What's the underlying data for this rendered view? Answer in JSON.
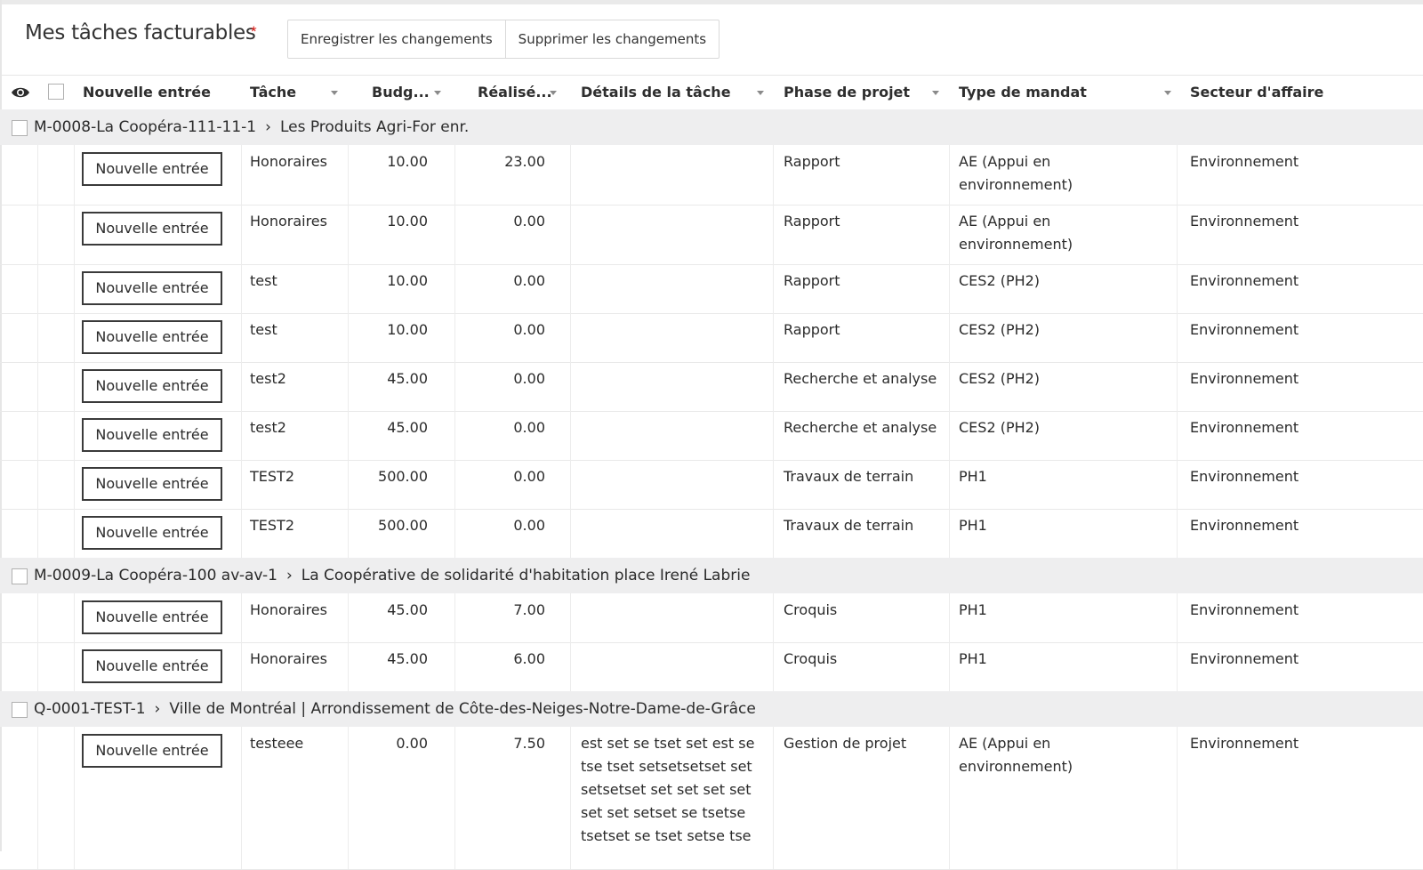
{
  "page": {
    "title": "Mes tâches facturables",
    "required_marker": "*",
    "save_label": "Enregistrer les changements",
    "discard_label": "Supprimer les changements"
  },
  "columns": {
    "new_entry": "Nouvelle entrée",
    "task": "Tâche",
    "budget": "Budg...",
    "done": "Réalisé...",
    "details": "Détails de la tâche",
    "phase": "Phase de projet",
    "mandate": "Type de mandat",
    "sector": "Secteur d'affaire"
  },
  "groups": [
    {
      "code": "M-0008-La Coopéra-111-11-1",
      "separator": "›",
      "client": "Les Produits Agri-For enr.",
      "rows": [
        {
          "button": "Nouvelle entrée",
          "task": "Honoraires",
          "budget": "10.00",
          "done": "23.00",
          "details": "",
          "phase": "Rapport",
          "mandate": "AE (Appui en environnement)",
          "sector": "Environnement"
        },
        {
          "button": "Nouvelle entrée",
          "task": "Honoraires",
          "budget": "10.00",
          "done": "0.00",
          "details": "",
          "phase": "Rapport",
          "mandate": "AE (Appui en environnement)",
          "sector": "Environnement"
        },
        {
          "button": "Nouvelle entrée",
          "task": "test",
          "budget": "10.00",
          "done": "0.00",
          "details": "",
          "phase": "Rapport",
          "mandate": "CES2 (PH2)",
          "sector": "Environnement"
        },
        {
          "button": "Nouvelle entrée",
          "task": "test",
          "budget": "10.00",
          "done": "0.00",
          "details": "",
          "phase": "Rapport",
          "mandate": "CES2 (PH2)",
          "sector": "Environnement"
        },
        {
          "button": "Nouvelle entrée",
          "task": "test2",
          "budget": "45.00",
          "done": "0.00",
          "details": "",
          "phase": "Recherche et analyse",
          "mandate": "CES2 (PH2)",
          "sector": "Environnement"
        },
        {
          "button": "Nouvelle entrée",
          "task": "test2",
          "budget": "45.00",
          "done": "0.00",
          "details": "",
          "phase": "Recherche et analyse",
          "mandate": "CES2 (PH2)",
          "sector": "Environnement"
        },
        {
          "button": "Nouvelle entrée",
          "task": "TEST2",
          "budget": "500.00",
          "done": "0.00",
          "details": "",
          "phase": "Travaux de terrain",
          "mandate": "PH1",
          "sector": "Environnement"
        },
        {
          "button": "Nouvelle entrée",
          "task": "TEST2",
          "budget": "500.00",
          "done": "0.00",
          "details": "",
          "phase": "Travaux de terrain",
          "mandate": "PH1",
          "sector": "Environnement"
        }
      ]
    },
    {
      "code": "M-0009-La Coopéra-100 av-av-1",
      "separator": "›",
      "client": "La Coopérative de solidarité d'habitation place Irené Labrie",
      "rows": [
        {
          "button": "Nouvelle entrée",
          "task": "Honoraires",
          "budget": "45.00",
          "done": "7.00",
          "details": "",
          "phase": "Croquis",
          "mandate": "PH1",
          "sector": "Environnement"
        },
        {
          "button": "Nouvelle entrée",
          "task": "Honoraires",
          "budget": "45.00",
          "done": "6.00",
          "details": "",
          "phase": "Croquis",
          "mandate": "PH1",
          "sector": "Environnement"
        }
      ]
    },
    {
      "code": "Q-0001-TEST-1",
      "separator": "›",
      "client": "Ville de Montréal | Arrondissement de Côte-des-Neiges-Notre-Dame-de-Grâce",
      "rows": [
        {
          "button": "Nouvelle entrée",
          "task": "testeee",
          "budget": "0.00",
          "done": "7.50",
          "details": "est set se tset set est se tse tset setsetsetset set setsetset set set set set set set setset se tsetse tsetset se tset setse tse",
          "phase": "Gestion de projet",
          "mandate": "AE (Appui en environnement)",
          "sector": "Environnement"
        }
      ]
    }
  ]
}
